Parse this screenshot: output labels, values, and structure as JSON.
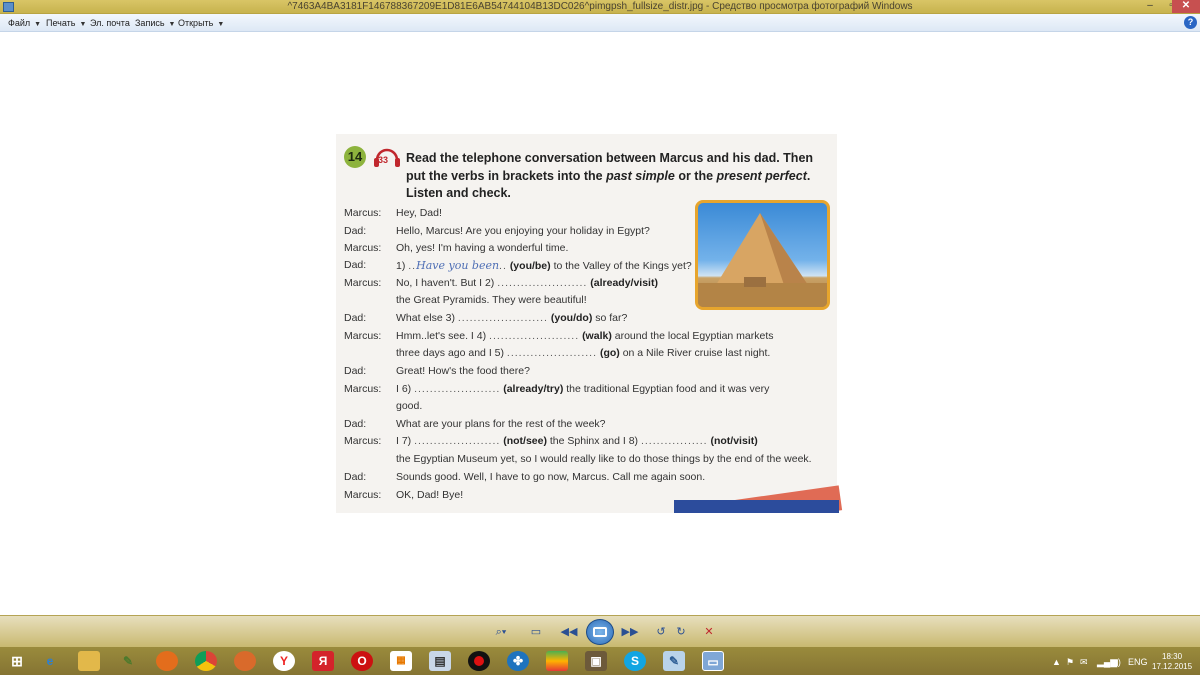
{
  "window": {
    "title": "^7463A4BA3181F146788367209E1D81E6AB54744104B13DC026^pimgpsh_fullsize_distr.jpg - Средство просмотра фотографий Windows"
  },
  "menu": {
    "file": "Файл",
    "print": "Печать",
    "email": "Эл. почта",
    "burn": "Запись",
    "open": "Открыть",
    "help": "?"
  },
  "exercise": {
    "number": "14",
    "track": "33",
    "instruction_part1": "Read the telephone conversation between Marcus and his dad. Then put the verbs in brackets into the",
    "past_simple": "past simple",
    "or_the": "or the",
    "present_perfect": "present perfect",
    "instruction_end": "Listen and check.",
    "lines": [
      {
        "speaker": "Marcus:",
        "text": "Hey, Dad!"
      },
      {
        "speaker": "Dad:",
        "text": "Hello, Marcus! Are you enjoying your holiday in Egypt?"
      },
      {
        "speaker": "Marcus:",
        "text": "Oh, yes! I'm having a wonderful time."
      },
      {
        "speaker": "Dad:",
        "pre": "1)",
        "handwriting": "Have you been",
        "bold": "(you/be)",
        "post": "to the Valley of the Kings yet?"
      },
      {
        "speaker": "Marcus:",
        "pre": "No, I haven't. But I 2)",
        "bold": "(already/visit)"
      },
      {
        "speaker": "",
        "text": "the Great Pyramids. They were beautiful!"
      },
      {
        "speaker": "Dad:",
        "pre": "What else 3)",
        "bold": "(you/do)",
        "post": "so far?"
      },
      {
        "speaker": "Marcus:",
        "pre": "Hmm..let's see. I 4)",
        "bold": "(walk)",
        "post": "around the local Egyptian markets"
      },
      {
        "speaker": "",
        "pre": "three days ago and I 5)",
        "bold": "(go)",
        "post": "on a Nile River cruise last night."
      },
      {
        "speaker": "Dad:",
        "text": "Great! How's the food there?"
      },
      {
        "speaker": "Marcus:",
        "pre": "I 6)",
        "bold": "(already/try)",
        "post": "the traditional Egyptian food and it was very"
      },
      {
        "speaker": "",
        "text": "good."
      },
      {
        "speaker": "Dad:",
        "text": "What are your plans for the rest of the week?"
      },
      {
        "speaker": "Marcus:",
        "pre": "I 7)",
        "bold": "(not/see)",
        "post": "the Sphinx and I 8)",
        "bold2": "(not/visit)"
      },
      {
        "speaker": "",
        "text": "the Egyptian Museum yet, so I would really like to do those things by the end of the week."
      },
      {
        "speaker": "Dad:",
        "text": "Sounds good. Well, I have to go now, Marcus. Call me again soon."
      },
      {
        "speaker": "Marcus:",
        "text": "OK, Dad! Bye!"
      }
    ]
  },
  "taskbar": {
    "lang": "ENG",
    "time": "18:30",
    "date": "17.12.2015"
  },
  "colors": {
    "titlebar": "#d9c566",
    "taskbar": "#857433",
    "badge": "#8db33d",
    "accent_red": "#c0272d"
  }
}
